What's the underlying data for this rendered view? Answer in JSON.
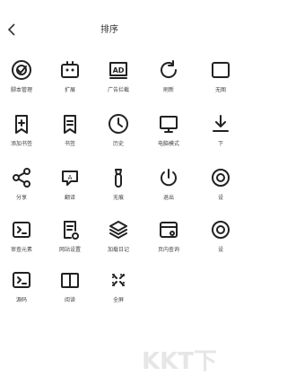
{
  "header": {
    "title": "排序"
  },
  "rows": [
    [
      {
        "label": "脚本管理",
        "icon": "script-icon"
      },
      {
        "label": "扩展",
        "icon": "extension-icon"
      },
      {
        "label": "广告拦截",
        "icon": "ad-block-icon"
      },
      {
        "label": "刷新",
        "icon": "refresh-icon"
      },
      {
        "label": "无图",
        "icon": "no-image-icon"
      }
    ],
    [
      {
        "label": "添加书签",
        "icon": "add-bookmark-icon"
      },
      {
        "label": "书签",
        "icon": "bookmark-icon"
      },
      {
        "label": "历史",
        "icon": "history-icon"
      },
      {
        "label": "电脑模式",
        "icon": "desktop-mode-icon"
      },
      {
        "label": "下",
        "icon": "download-icon"
      }
    ],
    [
      {
        "label": "分享",
        "icon": "share-icon"
      },
      {
        "label": "翻译",
        "icon": "translate-icon"
      },
      {
        "label": "无痕",
        "icon": "incognito-icon"
      },
      {
        "label": "退出",
        "icon": "power-icon"
      },
      {
        "label": "设",
        "icon": "settings-icon"
      }
    ],
    [
      {
        "label": "审查元素",
        "icon": "inspect-icon"
      },
      {
        "label": "网站设置",
        "icon": "site-settings-icon"
      },
      {
        "label": "加载日记",
        "icon": "load-log-icon"
      },
      {
        "label": "页内查询",
        "icon": "find-in-page-icon"
      },
      {
        "label": "设",
        "icon": "settings-icon"
      }
    ],
    [
      {
        "label": "源码",
        "icon": "source-icon"
      },
      {
        "label": "阅读",
        "icon": "reader-icon"
      },
      {
        "label": "全屏",
        "icon": "fullscreen-icon"
      }
    ]
  ],
  "watermark": "KKT下"
}
